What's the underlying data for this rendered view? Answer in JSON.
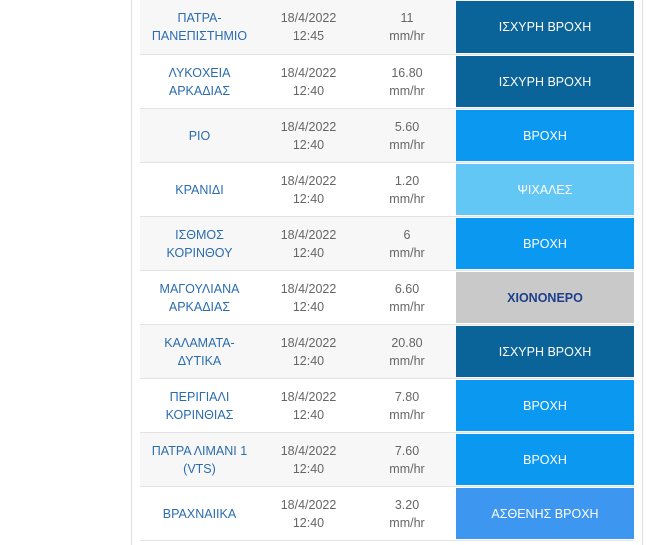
{
  "table": {
    "rows": [
      {
        "station": "ΠΑΤΡΑ-ΠΑΝΕΠΙΣΤΗΜΙΟ",
        "station_l1": "ΠΑΤΡΑ-",
        "station_l2": "ΠΑΝΕΠΙΣΤΗΜΙΟ",
        "date": "18/4/2022",
        "time": "12:45",
        "value": "11",
        "unit": "mm/hr",
        "status": "ΙΣΧΥΡΗ ΒΡΟΧΗ",
        "status_color": "#0a6399"
      },
      {
        "station": "ΛΥΚΟΧΕΙΑ ΑΡΚΑΔΙΑΣ",
        "station_l1": "ΛΥΚΟΧΕΙΑ",
        "station_l2": "ΑΡΚΑΔΙΑΣ",
        "date": "18/4/2022",
        "time": "12:40",
        "value": "16.80",
        "unit": "mm/hr",
        "status": "ΙΣΧΥΡΗ ΒΡΟΧΗ",
        "status_color": "#0a6399"
      },
      {
        "station": "ΡΙΟ",
        "station_l1": "ΡΙΟ",
        "station_l2": "",
        "date": "18/4/2022",
        "time": "12:40",
        "value": "5.60",
        "unit": "mm/hr",
        "status": "ΒΡΟΧΗ",
        "status_color": "#0a98f0"
      },
      {
        "station": "ΚΡΑΝΙΔΙ",
        "station_l1": "ΚΡΑΝΙΔΙ",
        "station_l2": "",
        "date": "18/4/2022",
        "time": "12:40",
        "value": "1.20",
        "unit": "mm/hr",
        "status": "ΨΙΧΑΛΕΣ",
        "status_color": "#63c7f5"
      },
      {
        "station": "ΙΣΘΜΟΣ ΚΟΡΙΝΘΟΥ",
        "station_l1": "ΙΣΘΜΟΣ",
        "station_l2": "ΚΟΡΙΝΘΟΥ",
        "date": "18/4/2022",
        "time": "12:40",
        "value": "6",
        "unit": "mm/hr",
        "status": "ΒΡΟΧΗ",
        "status_color": "#0a98f0"
      },
      {
        "station": "ΜΑΓΟΥΛΙΑΝΑ ΑΡΚΑΔΙΑΣ",
        "station_l1": "ΜΑΓΟΥΛΙΑΝΑ",
        "station_l2": "ΑΡΚΑΔΙΑΣ",
        "date": "18/4/2022",
        "time": "12:40",
        "value": "6.60",
        "unit": "mm/hr",
        "status": "ΧΙΟΝΟΝΕΡΟ",
        "status_color": "#c9c9c9"
      },
      {
        "station": "ΚΑΛΑΜΑΤΑ-ΔΥΤΙΚΑ",
        "station_l1": "ΚΑΛΑΜΑΤΑ-",
        "station_l2": "ΔΥΤΙΚΑ",
        "date": "18/4/2022",
        "time": "12:40",
        "value": "20.80",
        "unit": "mm/hr",
        "status": "ΙΣΧΥΡΗ ΒΡΟΧΗ",
        "status_color": "#0a6399"
      },
      {
        "station": "ΠΕΡΙΓΙΑΛΙ ΚΟΡΙΝΘΙΑΣ",
        "station_l1": "ΠΕΡΙΓΙΑΛΙ",
        "station_l2": "ΚΟΡΙΝΘΙΑΣ",
        "date": "18/4/2022",
        "time": "12:40",
        "value": "7.80",
        "unit": "mm/hr",
        "status": "ΒΡΟΧΗ",
        "status_color": "#0a98f0"
      },
      {
        "station": "ΠΑΤΡΑ ΛΙΜΑΝΙ 1 (VTS)",
        "station_l1": "ΠΑΤΡΑ ΛΙΜΑΝΙ 1",
        "station_l2": "(VTS)",
        "date": "18/4/2022",
        "time": "12:40",
        "value": "7.60",
        "unit": "mm/hr",
        "status": "ΒΡΟΧΗ",
        "status_color": "#0a98f0"
      },
      {
        "station": "ΒΡΑΧΝΑΙΙΚΑ",
        "station_l1": "ΒΡΑΧΝΑΙΙΚΑ",
        "station_l2": "",
        "date": "18/4/2022",
        "time": "12:40",
        "value": "3.20",
        "unit": "mm/hr",
        "status": "ΑΣΘΕΝΗΣ ΒΡΟΧΗ",
        "status_color": "#3d97f0"
      }
    ]
  }
}
